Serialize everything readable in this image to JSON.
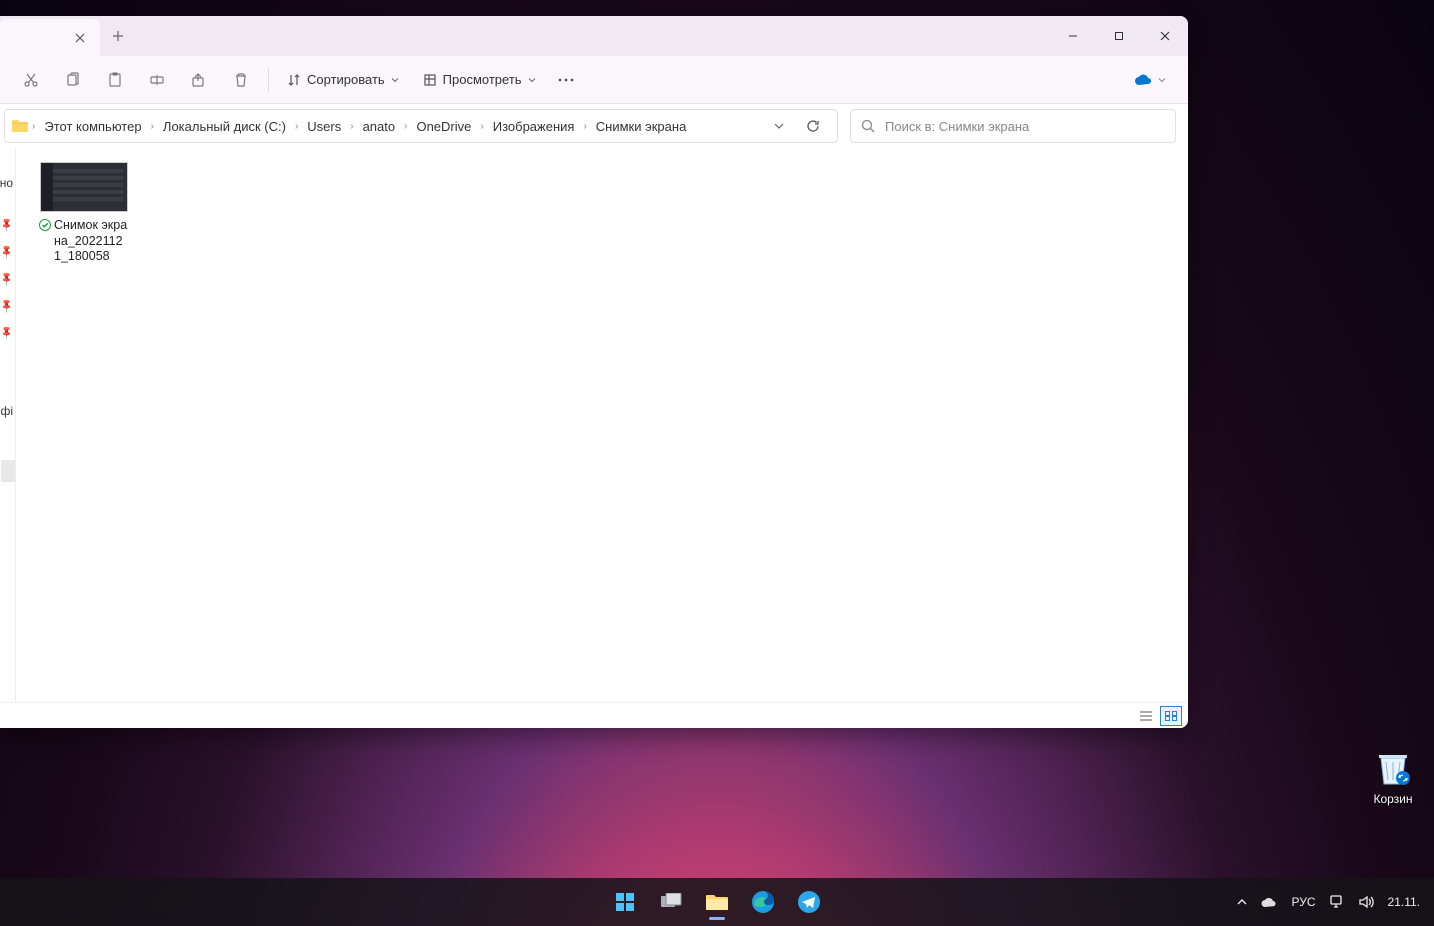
{
  "toolbar": {
    "sort_label": "Сортировать",
    "view_label": "Просмотреть"
  },
  "breadcrumbs": [
    "Этот компьютер",
    "Локальный диск (C:)",
    "Users",
    "anato",
    "OneDrive",
    "Изображения",
    "Снимки экрана"
  ],
  "search": {
    "placeholder": "Поиск в: Снимки экрана"
  },
  "sidebar": {
    "label_top": "но",
    "label_mid": "фі"
  },
  "file": {
    "name": "Снимок экрана_20221121_180058"
  },
  "desktop": {
    "recycle": "Корзин"
  },
  "tray": {
    "lang": "РУС",
    "date": "21.11."
  }
}
